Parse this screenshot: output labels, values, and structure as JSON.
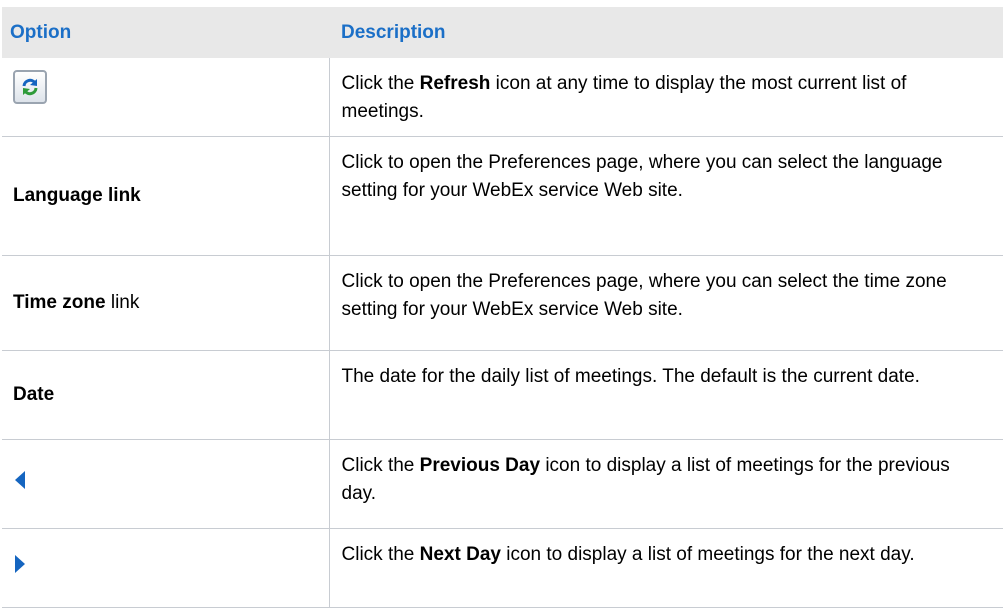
{
  "header": {
    "option": "Option",
    "description": "Description"
  },
  "rows": [
    {
      "icon": "refresh-icon",
      "desc_pre": "Click the ",
      "desc_bold": "Refresh",
      "desc_post": " icon at any time to display the most current list of meetings."
    },
    {
      "option_bold": "Language link",
      "desc": "Click to open the Preferences page, where you can select the language setting for your WebEx service Web site."
    },
    {
      "option_bold": "Time zone",
      "option_normal": " link",
      "desc": "Click to open the Preferences page, where you can select the time zone setting for your WebEx service Web site."
    },
    {
      "option_bold": "Date",
      "desc": "The date for the daily list of meetings. The default is the current date."
    },
    {
      "icon": "previous-day-arrow-icon",
      "desc_pre": "Click the ",
      "desc_bold": "Previous Day",
      "desc_post": " icon to display a list of meetings for the previous day."
    },
    {
      "icon": "next-day-arrow-icon",
      "desc_pre": "Click the ",
      "desc_bold": "Next Day",
      "desc_post": " icon to display a list of meetings for the next day."
    }
  ],
  "colors": {
    "header_text": "#1b6fc7",
    "header_bg": "#e8e8e8",
    "icon_blue": "#1565c0",
    "refresh_green": "#2e9b3a"
  }
}
